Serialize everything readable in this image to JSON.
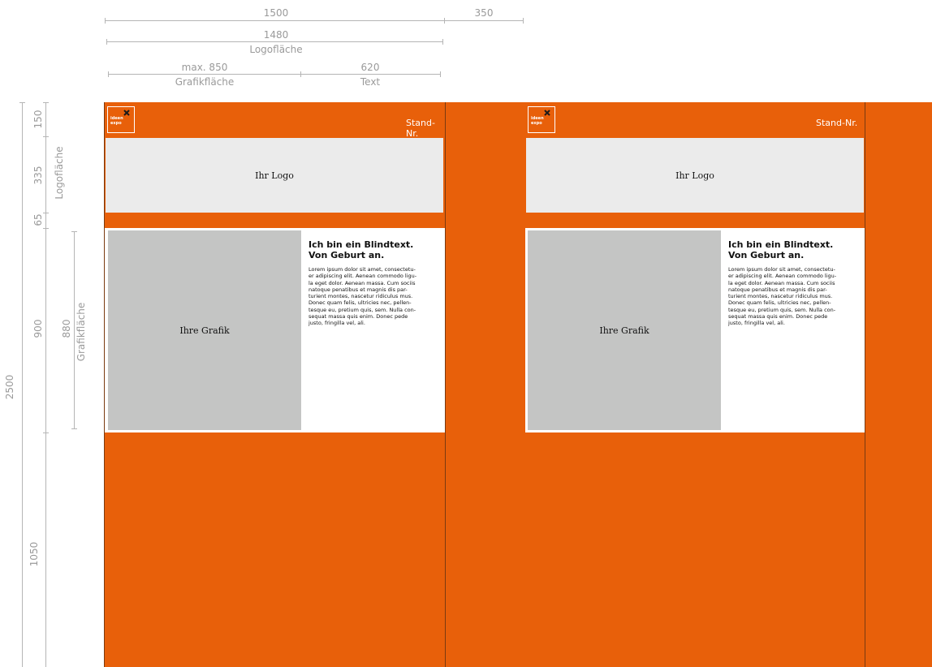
{
  "dims": {
    "top_total": "1500",
    "top_gap": "350",
    "logo_width": "1480",
    "logo_width_label": "Logofläche",
    "graphic_width": "max. 850",
    "graphic_width_label": "Grafikfläche",
    "text_width": "620",
    "text_width_label": "Text",
    "v_header": "150",
    "v_logo": "335",
    "v_logo_label": "Logofläche",
    "v_spacer": "65",
    "v_content": "900",
    "v_graphic": "880",
    "v_graphic_label": "Grafikfläche",
    "v_bottom": "1050",
    "v_total": "2500"
  },
  "colors": {
    "orange": "#e8600a",
    "logo_bg": "#ebebeb",
    "graphic_bg": "#c4c5c4",
    "dim": "#9a9a9a"
  },
  "panels": [
    {
      "brand_line1": "ideen",
      "brand_line2": "expo",
      "stand_label": "Stand-Nr.",
      "logo_placeholder": "Ihr Logo",
      "graphic_placeholder": "Ihre Grafik",
      "headline_1": "Ich bin ein Blindtext.",
      "headline_2": "Von Geburt an.",
      "body": "Lorem ipsum dolor sit amet, consectetu-\ner adipiscing elit. Aenean commodo ligu-\nla eget dolor. Aenean massa. Cum sociis\nnatoque penatibus et magnis dis par-\nturient montes, nascetur ridiculus mus.\nDonec quam felis, ultricies nec, pellen-\ntesque eu, pretium quis, sem. Nulla con-\nsequat massa quis enim. Donec pede\njusto, fringilla vel, ali."
    },
    {
      "brand_line1": "ideen",
      "brand_line2": "expo",
      "stand_label": "Stand-Nr.",
      "logo_placeholder": "Ihr Logo",
      "graphic_placeholder": "Ihre Grafik",
      "headline_1": "Ich bin ein Blindtext.",
      "headline_2": "Von Geburt an.",
      "body": "Lorem ipsum dolor sit amet, consectetu-\ner adipiscing elit. Aenean commodo ligu-\nla eget dolor. Aenean massa. Cum sociis\nnatoque penatibus et magnis dis par-\nturient montes, nascetur ridiculus mus.\nDonec quam felis, ultricies nec, pellen-\ntesque eu, pretium quis, sem. Nulla con-\nsequat massa quis enim. Donec pede\njusto, fringilla vel, ali."
    }
  ]
}
